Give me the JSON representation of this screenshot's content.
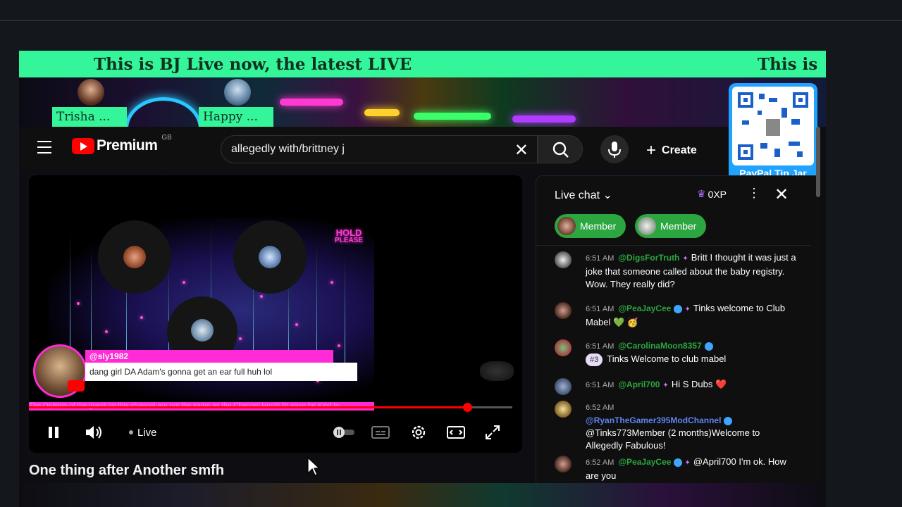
{
  "ticker": {
    "text": "This is BJ Live now, the latest LIVE",
    "text_repeat": "This is"
  },
  "guests": [
    {
      "name": "Trisha ..."
    },
    {
      "name": "Happy ..."
    }
  ],
  "tip_jar": {
    "label": "PayPal Tip Jar"
  },
  "header": {
    "logo_text": "Premium",
    "region": "GB",
    "search_query": "allegedly with/brittney j",
    "create_label": "Create"
  },
  "player": {
    "hold_text_line1": "HOLD",
    "hold_text_line2": "PLEASE",
    "comment_author": "@sly1982",
    "comment_text": "dang girl DA Adam's gonna get an ear full huh lol",
    "disclaimer": "The Opinion of the guest on this channel are not the same as the Channel Host!! PLease be Kind to",
    "live_label": "Live",
    "progress_fraction": 0.907
  },
  "video_title": "One thing after Another smfh",
  "chat": {
    "title": "Live chat",
    "xp": "0XP",
    "member_pills": [
      "Member",
      "Member"
    ],
    "messages": [
      {
        "time": "6:51 AM",
        "author": "@DigsForTruth",
        "text": "Britt I thought it was just a joke that someone called about the baby registry. Wow. They really did?"
      },
      {
        "time": "6:51 AM",
        "author": "@PeaJayCee",
        "text": "Tinks welcome to Club Mabel 💚 🥳"
      },
      {
        "time": "6:51 AM",
        "author": "@CarolinaMoon8357",
        "rank": "#3",
        "text": "Tinks Welcome to club mabel"
      },
      {
        "time": "6:51 AM",
        "author": "@April700",
        "text": "Hi S Dubs ❤️"
      },
      {
        "time": "6:52 AM",
        "author": "@RyanTheGamer395ModChannel",
        "text": "@Tinks773Member (2 months)Welcome to Allegedly Fabulous!"
      },
      {
        "time": "6:52 AM",
        "author": "@PeaJayCee",
        "text": "@April700 I'm ok. How are you"
      }
    ]
  },
  "colors": {
    "ticker_bg": "#35f59a",
    "tip_jar_bg": "#1fa3ff",
    "comment_accent": "#ff2bd6",
    "member_green": "#2ba640",
    "yt_red": "#ff0000"
  }
}
